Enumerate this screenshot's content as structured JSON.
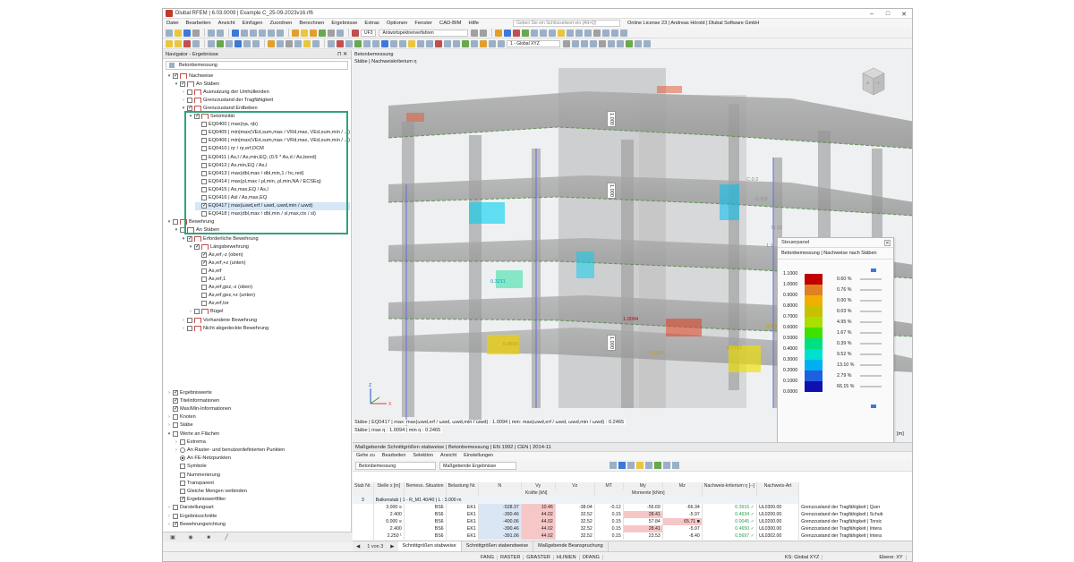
{
  "title": "Dlubal RFEM | 6.03.0009 | Example C_25-09-2023v16.rf6",
  "menu": [
    "Datei",
    "Bearbeiten",
    "Ansicht",
    "Einfügen",
    "Zuordnen",
    "Berechnen",
    "Ergebnisse",
    "Extras",
    "Optionen",
    "Fenster",
    "CAD-BIM",
    "Hilfe"
  ],
  "search_placeholder": "Geben Sie ein Schlüsselwort ein (Alt+Q)",
  "license": "Online License 23 | Andreas Hörold | Dlubal Software GmbH",
  "toolbar": {
    "load_case": "UF3",
    "spectrum": "Antwortspektrenverfahren",
    "coord": "1 - Global XYZ"
  },
  "navigator": {
    "title": "Navigator - Ergebnisse",
    "dropdown": "Betonbemessung",
    "tree": [
      {
        "label": "Nachweise",
        "indent": 0,
        "ex": "▾",
        "cb": "on",
        "icon": true
      },
      {
        "label": "An Stäben",
        "indent": 1,
        "ex": "▾",
        "cb": "on",
        "icon": true
      },
      {
        "label": "Ausnutzung der Umhüllenden",
        "indent": 2,
        "ex": "›",
        "cb": "",
        "icon": true
      },
      {
        "label": "Grenzzustand der Tragfähigkeit",
        "indent": 2,
        "ex": "›",
        "cb": "",
        "icon": true
      },
      {
        "label": "Grenzzustand Erdbeben",
        "indent": 2,
        "ex": "▾",
        "cb": "on",
        "icon": true
      },
      {
        "label": "Seismizität",
        "indent": 3,
        "ex": "▾",
        "cb": "on",
        "icon": true
      },
      {
        "label": "EQ0400 | max(ηa, ηb)",
        "indent": 4,
        "ex": "",
        "cb": "",
        "icon": false
      },
      {
        "label": "EQ0405 | min|max(VEd,sum,max / VRd,max, VEd,sum,min / ...)",
        "indent": 4,
        "ex": "",
        "cb": "",
        "icon": false
      },
      {
        "label": "EQ0406 | min|max(VEd,sum,max / VRd,max, VEd,sum,min / ...)",
        "indent": 4,
        "ex": "",
        "cb": "",
        "icon": false
      },
      {
        "label": "EQ0410 | ηr / ηr,erf,DCM",
        "indent": 4,
        "ex": "",
        "cb": "",
        "icon": false
      },
      {
        "label": "EQ0411 | As,l / As,min,EQ, (0.5 * As,d / As,bend)",
        "indent": 4,
        "ex": "",
        "cb": "",
        "icon": false
      },
      {
        "label": "EQ0412 | As,min,EQ / As,l",
        "indent": 4,
        "ex": "",
        "cb": "",
        "icon": false
      },
      {
        "label": "EQ0413 | max(dbl,max / dbl,min,1 / hc,red)",
        "indent": 4,
        "ex": "",
        "cb": "",
        "icon": false
      },
      {
        "label": "EQ0414 | max(ρl,max / ρl,min, ρl,min,NA / ECSEq)",
        "indent": 4,
        "ex": "",
        "cb": "",
        "icon": false
      },
      {
        "label": "EQ0415 | As,max,EQ / As,l",
        "indent": 4,
        "ex": "",
        "cb": "",
        "icon": false
      },
      {
        "label": "EQ0416 | Asl / As,max,EQ",
        "indent": 4,
        "ex": "",
        "cb": "",
        "icon": false
      },
      {
        "label": "EQ0417 | max(ωwd,erf / ωwd, ωwd,min / ωwd)",
        "indent": 4,
        "ex": "",
        "cb": "on",
        "icon": false,
        "sel": true
      },
      {
        "label": "EQ0418 | max(dbl,max / dbl,min / sl,max,ctx / sl)",
        "indent": 4,
        "ex": "",
        "cb": "",
        "icon": false
      },
      {
        "label": "Bewehrung",
        "indent": 0,
        "ex": "▾",
        "cb": "",
        "icon": true
      },
      {
        "label": "An Stäben",
        "indent": 1,
        "ex": "▾",
        "cb": "",
        "icon": true
      },
      {
        "label": "Erforderliche Bewehrung",
        "indent": 2,
        "ex": "▾",
        "cb": "on",
        "icon": true
      },
      {
        "label": "Längsbewehrung",
        "indent": 3,
        "ex": "▾",
        "cb": "on",
        "icon": true
      },
      {
        "label": "As,erf,-z (oben)",
        "indent": 4,
        "ex": "",
        "cb": "on",
        "icon": false
      },
      {
        "label": "As,erf,+z (unten)",
        "indent": 4,
        "ex": "",
        "cb": "on",
        "icon": false
      },
      {
        "label": "As,erf",
        "indent": 4,
        "ex": "",
        "cb": "",
        "icon": false
      },
      {
        "label": "As,erf,1",
        "indent": 4,
        "ex": "",
        "cb": "",
        "icon": false
      },
      {
        "label": "As,erf,gez,-z (oben)",
        "indent": 4,
        "ex": "",
        "cb": "",
        "icon": false
      },
      {
        "label": "As,erf,gez,+z (unten)",
        "indent": 4,
        "ex": "",
        "cb": "",
        "icon": false
      },
      {
        "label": "As,erf,tor",
        "indent": 4,
        "ex": "",
        "cb": "",
        "icon": false
      },
      {
        "label": "Bügel",
        "indent": 3,
        "ex": "›",
        "cb": "",
        "icon": true
      },
      {
        "label": "Vorhandene Bewehrung",
        "indent": 2,
        "ex": "›",
        "cb": "",
        "icon": true
      },
      {
        "label": "Nicht abgedeckte Bewehrung",
        "indent": 2,
        "ex": "›",
        "cb": "",
        "icon": true
      }
    ],
    "display": [
      {
        "label": "Ergebniswerte",
        "indent": 0,
        "ex": "›",
        "cb": "on",
        "icon": "cb"
      },
      {
        "label": "Titelinformationen",
        "indent": 0,
        "ex": "",
        "cb": "on",
        "icon": "cb"
      },
      {
        "label": "Max/Min-Informationen",
        "indent": 0,
        "ex": "",
        "cb": "on",
        "icon": "cb"
      },
      {
        "label": "Knoten",
        "indent": 0,
        "ex": "›",
        "cb": "",
        "icon": "cb"
      },
      {
        "label": "Stäbe",
        "indent": 0,
        "ex": "›",
        "cb": "",
        "icon": "cb"
      },
      {
        "label": "Werte an Flächen",
        "indent": 0,
        "ex": "▾",
        "cb": "",
        "icon": "cb"
      },
      {
        "label": "Extrema",
        "indent": 1,
        "ex": "›",
        "cb": "",
        "icon": "cb"
      },
      {
        "label": "An Raster- und benutzerdefinierten Punkten",
        "indent": 1,
        "ex": "›",
        "cb": "",
        "icon": "rd"
      },
      {
        "label": "An FE-Netzpunkten",
        "indent": 1,
        "ex": "",
        "cb": "on",
        "icon": "rd"
      },
      {
        "label": "Symbole",
        "indent": 1,
        "ex": "",
        "cb": "",
        "icon": "cb"
      },
      {
        "label": "Nummerierung",
        "indent": 1,
        "ex": "",
        "cb": "",
        "icon": "cb"
      },
      {
        "label": "Transparent",
        "indent": 1,
        "ex": "",
        "cb": "",
        "icon": "cb"
      },
      {
        "label": "Gleiche Mengen verbinden",
        "indent": 1,
        "ex": "",
        "cb": "",
        "icon": "cb"
      },
      {
        "label": "Ergebniswertfilter",
        "indent": 1,
        "ex": "",
        "cb": "on",
        "icon": "cb"
      },
      {
        "label": "Darstellungsart",
        "indent": 0,
        "ex": "›",
        "cb": "",
        "icon": "cb"
      },
      {
        "label": "Ergebnisschnitte",
        "indent": 0,
        "ex": "›",
        "cb": "",
        "icon": "cb"
      },
      {
        "label": "Bewehrungsrichtung",
        "indent": 0,
        "ex": "›",
        "cb": "on",
        "icon": "cb"
      }
    ]
  },
  "view": {
    "title1": "Betonbemessung",
    "title2": "Stäbe | Nachweiskriterium η",
    "status1": "Stäbe | EQ0417 | max: max(ωwd,erf / ωwd, ωwd,min / ωwd) : 1.0094 | min: max(ωwd,erf / ωwd, ωwd,min / ωwd) : 0.2465",
    "status2": "Stäbe | max η : 1.0094 | min η : 0.2465",
    "labels": [
      "1.000",
      "1.000",
      "1.000",
      "1.0094",
      "0.6506",
      "0.4815",
      "0.6641",
      "0.7717",
      "0.3211",
      "C.0.2",
      "C.0.2",
      "N.12",
      "1.1"
    ],
    "unit": "[m]"
  },
  "panel": {
    "title": "Steuerpanel",
    "subtitle": "Betonbemessung | Nachweise nach Stäben",
    "legend": [
      {
        "v": "1.1000",
        "c": "#c00000",
        "p": "0.60 %"
      },
      {
        "v": "1.0000",
        "c": "#e08020",
        "p": "0.76 %"
      },
      {
        "v": "0.9000",
        "c": "#f0b000",
        "p": "0.00 %"
      },
      {
        "v": "0.8000",
        "c": "#c8c000",
        "p": "0.03 %"
      },
      {
        "v": "0.7000",
        "c": "#a8e000",
        "p": "4.95 %"
      },
      {
        "v": "0.6000",
        "c": "#40e000",
        "p": "1.67 %"
      },
      {
        "v": "0.5000",
        "c": "#00e080",
        "p": "0.39 %"
      },
      {
        "v": "0.4000",
        "c": "#00e0d0",
        "p": "9.52 %"
      },
      {
        "v": "0.3000",
        "c": "#00b0f0",
        "p": "13.10 %"
      },
      {
        "v": "0.2000",
        "c": "#2060e0",
        "p": "2.79 %"
      },
      {
        "v": "0.1000",
        "c": "#1010b0",
        "p": "66.15 %"
      },
      {
        "v": "0.0000",
        "c": "",
        "p": ""
      }
    ]
  },
  "results": {
    "title": "Maßgebende Schnittgrößen stabweise | Betonbemessung | EN 1992 | CEN | 2014-11",
    "menu": [
      "Gehe zu",
      "Bearbeiten",
      "Selektion",
      "Ansicht",
      "Einstellungen"
    ],
    "dd1": "Betonbemessung",
    "dd2": "Maßgebende Ergebnisse",
    "cols": [
      "Stab Nr.",
      "Stelle x [m]",
      "Bemess. Situation",
      "Belastung Nr.",
      "N",
      "Vy",
      "Vz",
      "MT",
      "My",
      "Mz",
      "Nachweis-kriterium η [--]",
      "Nachweis-Art"
    ],
    "group_forces": "Kräfte [kN]",
    "group_moments": "Momente [kNm]",
    "member_no": "3",
    "member_desc": "Balkenstab | 1 - R_M1 40/40 | L : 3.000 m",
    "rows": [
      [
        "3.000 ≡",
        "BS6",
        "EK1",
        "-528.37",
        "10.46",
        "-38.04",
        "-0.12",
        "-56.69",
        "-66.34",
        "0.3916 ✓",
        "UL0300.00",
        "Grenzzustand der Tragfähigkeit | Quer"
      ],
      [
        "2.400",
        "BS6",
        "EK1",
        "-390.46",
        "44.02",
        "32.52",
        "0.15",
        "28.41",
        "-5.97",
        "0.4634 ✓",
        "UL0200.00",
        "Grenzzustand der Tragfähigkeit | Schub"
      ],
      [
        "0.000 ≡",
        "BS6",
        "EK1",
        "-400.06",
        "44.02",
        "32.52",
        "0.15",
        "57.84",
        "65.71 ■",
        "0.0045 ✓",
        "UL0200.00",
        "Grenzzustand der Tragfähigkeit | Torsic"
      ],
      [
        "2.400",
        "BS6",
        "EK1",
        "-390.46",
        "44.02",
        "32.52",
        "0.15",
        "28.41",
        "-5.97",
        "0.4650 ✓",
        "UL0300.00",
        "Grenzzustand der Tragfähigkeit | Intera"
      ],
      [
        "2.250 ¹",
        "BS6",
        "EK1",
        "-391.06",
        "44.02",
        "32.52",
        "0.15",
        "23.53",
        "-8.40",
        "0.5697 ✓",
        "UL0302.00",
        "Grenzzustand der Tragfähigkeit | Intera"
      ]
    ],
    "pager": "1 von 3",
    "tabs": [
      "Schnittgrößen stabweise",
      "Schnittgrößen stabendweise",
      "Maßgebende Beanspruchung"
    ]
  },
  "statusbar": [
    "FANG",
    "RASTER",
    "GRASTER",
    "HLINIEN",
    "OFANG"
  ],
  "status_coord": "KS: Global XYZ",
  "status_plane": "Ebene: XY"
}
